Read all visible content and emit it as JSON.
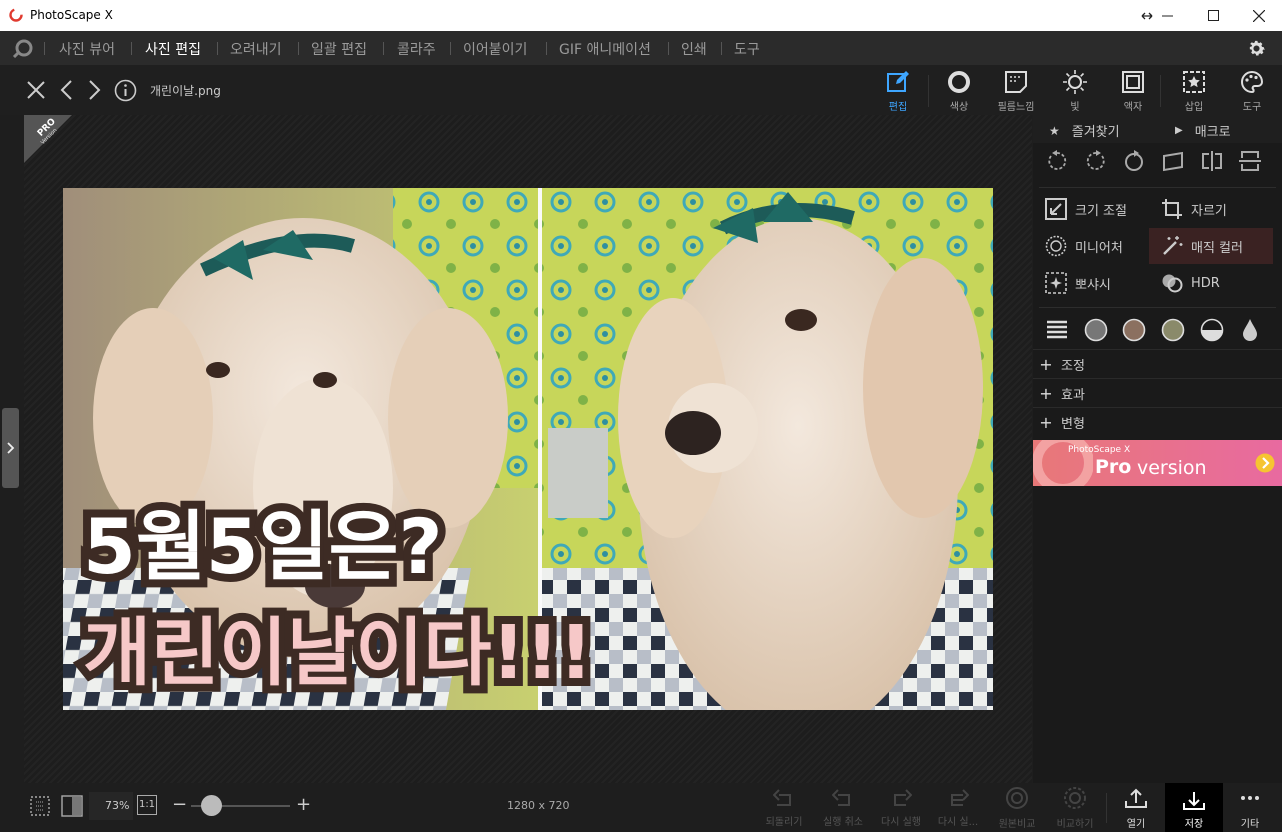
{
  "window": {
    "title": "PhotoScape X"
  },
  "nav": {
    "items": [
      {
        "label": "사진 뷰어",
        "active": false
      },
      {
        "label": "사진 편집",
        "active": true
      },
      {
        "label": "오려내기",
        "active": false
      },
      {
        "label": "일괄 편집",
        "active": false
      },
      {
        "label": "콜라주",
        "active": false
      },
      {
        "label": "이어붙이기",
        "active": false
      },
      {
        "label": "GIF 애니메이션",
        "active": false
      },
      {
        "label": "인쇄",
        "active": false
      },
      {
        "label": "도구",
        "active": false
      }
    ]
  },
  "file": {
    "name": "개린이날.png"
  },
  "toolbar": {
    "tools": [
      {
        "label": "편집",
        "icon": "pencil-square-icon",
        "active": true
      },
      {
        "label": "색상",
        "icon": "circle-icon",
        "active": false
      },
      {
        "label": "필름느낌",
        "icon": "film-frame-icon",
        "active": false
      },
      {
        "label": "빛",
        "icon": "sun-icon",
        "active": false
      },
      {
        "label": "액자",
        "icon": "frame-icon",
        "active": false
      },
      {
        "label": "삽입",
        "icon": "star-frame-icon",
        "active": false
      },
      {
        "label": "도구",
        "icon": "palette-icon",
        "active": false
      }
    ]
  },
  "badge": {
    "pro": "PRO",
    "version": "Version"
  },
  "photo": {
    "line1": "5월5일은?",
    "line2": "개린이날이다!!!"
  },
  "panel": {
    "favorites": "즐겨찾기",
    "macro": "매크로",
    "tools": [
      {
        "label": "크기 조절",
        "icon": "resize-icon"
      },
      {
        "label": "자르기",
        "icon": "crop-icon"
      },
      {
        "label": "미니어처",
        "icon": "miniature-icon"
      },
      {
        "label": "매직 컬러",
        "icon": "magic-wand-icon"
      },
      {
        "label": "뽀샤시",
        "icon": "sparkle-icon"
      },
      {
        "label": "HDR",
        "icon": "hdr-icon"
      }
    ],
    "sections": [
      "조정",
      "효과",
      "변형"
    ],
    "ad": {
      "brand": "PhotoScape X",
      "pro": "Pro",
      "version": "version"
    }
  },
  "bottom": {
    "zoom": "73%",
    "one_to_one": "1:1",
    "zoom_level": 0.22,
    "dimensions": "1280 x 720",
    "actions": [
      {
        "label": "되돌리기",
        "enabled": false
      },
      {
        "label": "실행 취소",
        "enabled": false
      },
      {
        "label": "다시 실행",
        "enabled": false
      },
      {
        "label": "다시 실...",
        "enabled": false
      },
      {
        "label": "원본비교",
        "enabled": false
      },
      {
        "label": "비교하기",
        "enabled": false
      }
    ],
    "open": "열기",
    "save": "저장",
    "more": "기타"
  },
  "colors": {
    "accent": "#3ea6ff",
    "magic_color_bg": "#3a2222"
  }
}
